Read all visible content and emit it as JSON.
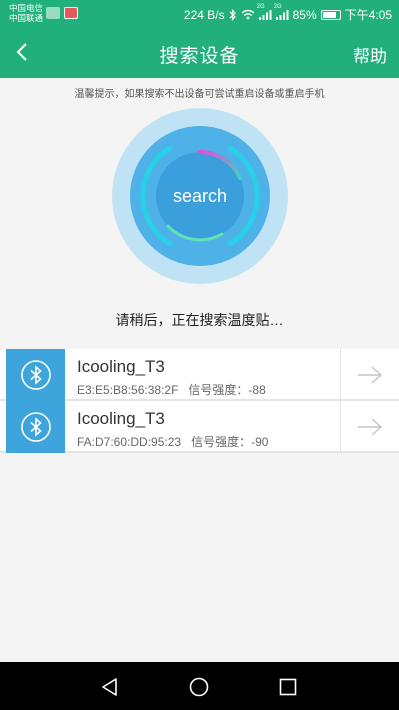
{
  "status_bar": {
    "carrier_1": "中国电信",
    "carrier_2": "中国联通",
    "speed": "224 B/s",
    "signal_1_badge": "2G",
    "signal_2_badge": "2G",
    "battery_percent": "85%",
    "battery_level": 0.85,
    "time": "下午4:05"
  },
  "header": {
    "title": "搜索设备",
    "help_label": "帮助",
    "back_icon": "chevron-left-icon"
  },
  "hint": "温馨提示，如果搜索不出设备可尝试重启设备或重启手机",
  "radar": {
    "button_label": "search",
    "outer_color": "#bfe3f5",
    "inner_color": "#4eb1e7"
  },
  "status_message": "请稍后，正在搜索温度贴…",
  "devices": [
    {
      "name": "Icooling_T3",
      "mac": "E3:E5:B8:56:38:2F",
      "rssi_label": "信号强度：",
      "rssi": "-88"
    },
    {
      "name": "Icooling_T3",
      "mac": "FA:D7:60:DD:95:23",
      "rssi_label": "信号强度：",
      "rssi": "-90"
    }
  ],
  "colors": {
    "accent": "#21b07b",
    "bluetooth_tile": "#3ea5dc"
  },
  "nav": {
    "back_icon": "triangle-back-icon",
    "home_icon": "circle-home-icon",
    "recents_icon": "square-recents-icon"
  }
}
